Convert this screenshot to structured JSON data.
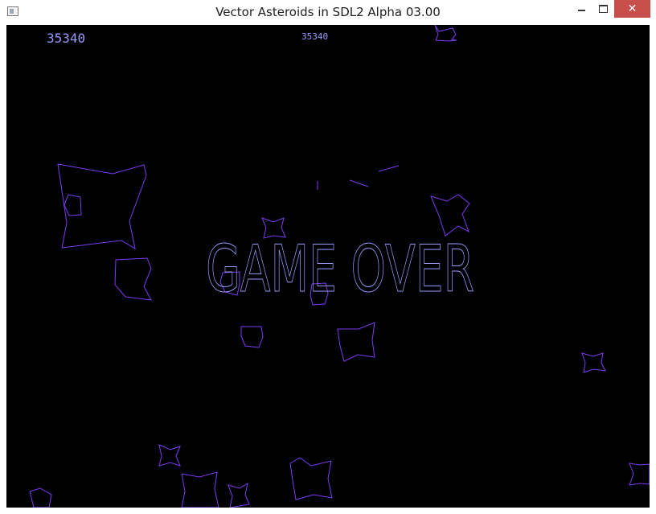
{
  "window": {
    "title": "Vector Asteroids in SDL2 Alpha 03.00",
    "close_glyph": "✕"
  },
  "hud": {
    "score": "35340",
    "high_score": "35340"
  },
  "message": "GAME OVER",
  "colors": {
    "vector": "#7b3cf0",
    "text": "#9b9bff",
    "background": "#000000",
    "close_button": "#c74f4b"
  }
}
